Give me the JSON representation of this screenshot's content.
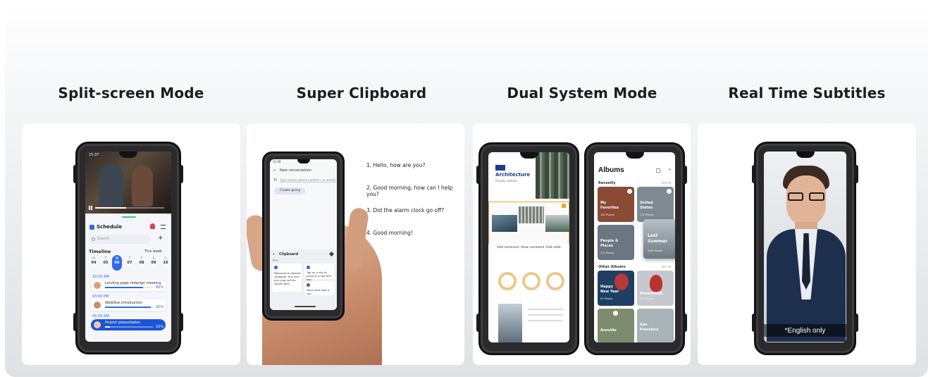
{
  "features": [
    {
      "title": "Split-screen Mode"
    },
    {
      "title": "Super Clipboard"
    },
    {
      "title": "Dual System Mode"
    },
    {
      "title": "Real Time Subtitles"
    }
  ],
  "split_screen": {
    "status_time": "15:37",
    "app_title": "Schedule",
    "search_placeholder": "Search",
    "timeline_label": "Timeline",
    "range_label": "This week",
    "days": [
      {
        "d": "M",
        "n": "04"
      },
      {
        "d": "T",
        "n": "05"
      },
      {
        "d": "W",
        "n": "06"
      },
      {
        "d": "T",
        "n": "07"
      },
      {
        "d": "F",
        "n": "08"
      },
      {
        "d": "S",
        "n": "09"
      },
      {
        "d": "S",
        "n": "10"
      }
    ],
    "events": [
      {
        "time": "10:00 AM",
        "title": "Landing page redesign meeting",
        "pct": "80%"
      },
      {
        "time": "03:00 PM",
        "title": "Webflow introduction",
        "pct": "95%"
      },
      {
        "time": "05:00 AM",
        "title": "Project presentation",
        "pct": "10%"
      }
    ]
  },
  "clipboard": {
    "status_time": "11:56",
    "header": "New conversation",
    "to_label": "To",
    "to_placeholder": "Type names, phone numbers, or emails",
    "create_group": "Create group",
    "panel_title": "Clipboard",
    "panel_sub": "Pins",
    "clip_1": "Welcome to Gboard clipboard. any text you copy will be saved here.",
    "clip_2": "Tap on a clip to paste it in the text box.",
    "clip_3": "Touch and hold a clip",
    "conversation": [
      "1. Hello, how are you?",
      "2. Good morning, how can I help you?",
      "3. Did the alarm clock go off?",
      "4. Good morning!"
    ]
  },
  "dual_system": {
    "doc_title": "Architecture",
    "doc_sub": "Display sample",
    "actions": [
      "Add comment",
      "View comment",
      "Edit slide"
    ],
    "albums_title": "Albums",
    "recently_label": "Recently",
    "see_all": "See all",
    "other_label": "Other Albums",
    "recent": [
      {
        "name": "My Favorites",
        "count": "186 Photos",
        "color": "#8a4a34"
      },
      {
        "name": "United States",
        "count": "274 Photos",
        "color": "#7e8a93"
      },
      {
        "name": "People & Places",
        "count": "232 Photos",
        "color": "#6b7683"
      },
      {
        "name": "Last Summer",
        "count": "296 Photos",
        "color": "#9aa3aa"
      }
    ],
    "other": [
      {
        "name": "Happy New Year",
        "count": "87 Photos",
        "color": "#1f3e63"
      },
      {
        "name": "Kleinmouth",
        "count": "252 Photos",
        "color": "#c5c9ce"
      },
      {
        "name": "Annville",
        "count": "",
        "color": "#7d8c6f"
      },
      {
        "name": "San Francisco",
        "count": "",
        "color": "#a6b3b7"
      }
    ]
  },
  "subtitles": {
    "caption": "*English only"
  },
  "colors": {
    "accent_blue": "#2f6bf0",
    "dark_blue": "#1a55d8",
    "orange_highlight": "#f0a33a"
  }
}
